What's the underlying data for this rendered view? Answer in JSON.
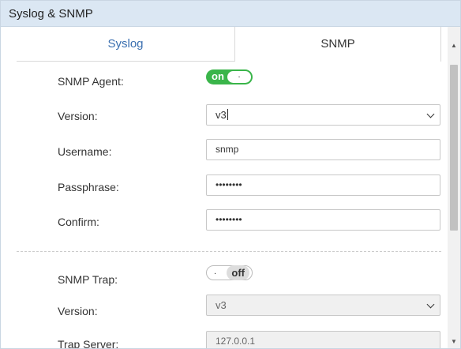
{
  "window": {
    "title": "Syslog & SNMP"
  },
  "tabs": [
    {
      "label": "Syslog",
      "active": false
    },
    {
      "label": "SNMP",
      "active": true
    }
  ],
  "snmp": {
    "agent_label": "SNMP Agent:",
    "agent_toggle": {
      "state": "on",
      "label": "on",
      "knob": "."
    },
    "version_label": "Version:",
    "version_value": "v3",
    "username_label": "Username:",
    "username_value": "snmp",
    "passphrase_label": "Passphrase:",
    "passphrase_value": "••••••••",
    "confirm_label": "Confirm:",
    "confirm_value": "••••••••",
    "trap_label": "SNMP Trap:",
    "trap_toggle": {
      "state": "off",
      "label": "off",
      "knob": "."
    },
    "trap_version_label": "Version:",
    "trap_version_value": "v3",
    "trap_server_label": "Trap Server:",
    "trap_server_value": "127.0.0.1"
  },
  "colors": {
    "accent": "#3a6fb0",
    "toggle_on": "#3ab54a",
    "titlebar": "#dbe7f3"
  },
  "icons": {
    "select_caret": "chevron-down-icon",
    "scroll_up": "scroll-up-arrow-icon",
    "scroll_down": "scroll-down-arrow-icon"
  }
}
